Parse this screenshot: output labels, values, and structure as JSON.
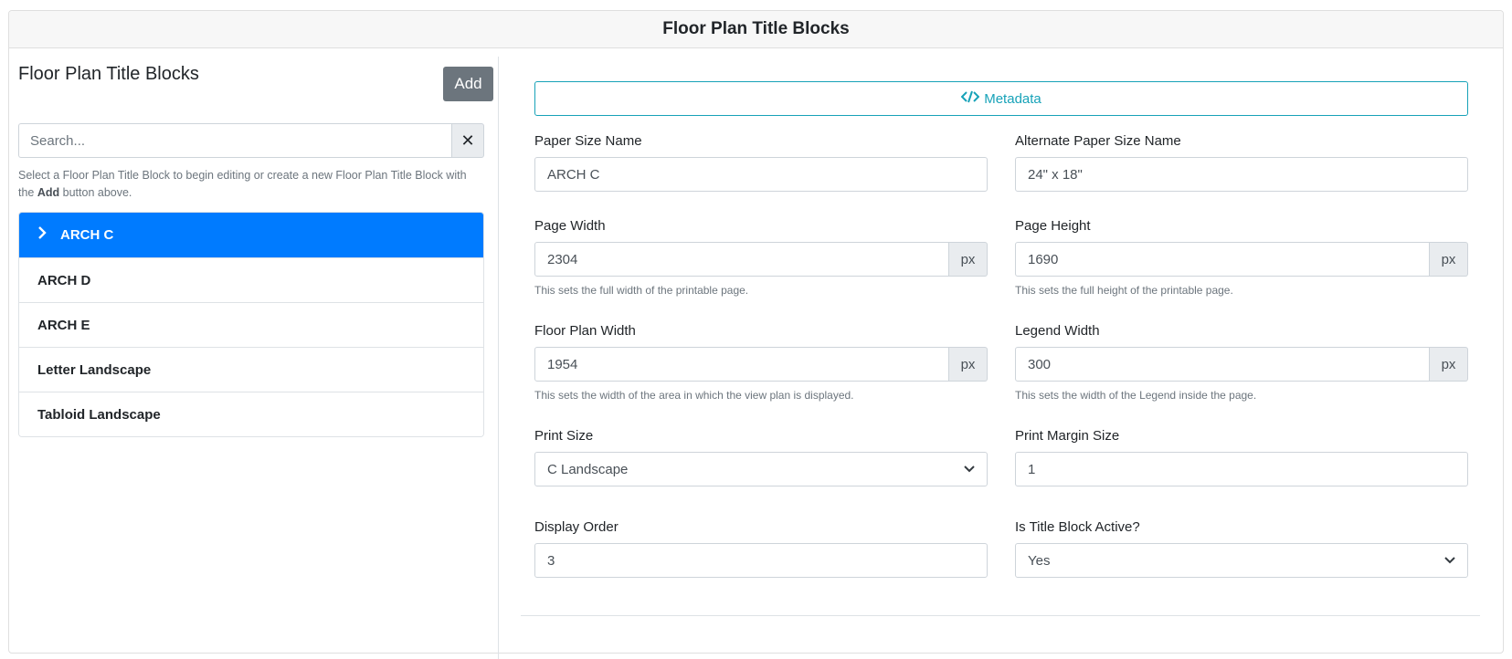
{
  "header": {
    "title": "Floor Plan Title Blocks"
  },
  "sidebar": {
    "title": "Floor Plan Title Blocks",
    "add_label": "Add",
    "search_placeholder": "Search...",
    "clear_icon": "✕",
    "help_prefix": "Select a Floor Plan Title Block to begin editing or create a new Floor Plan Title Block with the ",
    "help_bold": "Add",
    "help_suffix": " button above.",
    "items": [
      {
        "label": "ARCH C",
        "active": true
      },
      {
        "label": "ARCH D"
      },
      {
        "label": "ARCH E"
      },
      {
        "label": "Letter Landscape"
      },
      {
        "label": "Tabloid Landscape"
      }
    ]
  },
  "form": {
    "metadata_label": "Metadata",
    "paper_size_name": {
      "label": "Paper Size Name",
      "value": "ARCH C"
    },
    "alt_paper_size_name": {
      "label": "Alternate Paper Size Name",
      "value": "24\" x 18\""
    },
    "page_width": {
      "label": "Page Width",
      "value": "2304",
      "unit": "px",
      "help": "This sets the full width of the printable page."
    },
    "page_height": {
      "label": "Page Height",
      "value": "1690",
      "unit": "px",
      "help": "This sets the full height of the printable page."
    },
    "floor_plan_width": {
      "label": "Floor Plan Width",
      "value": "1954",
      "unit": "px",
      "help": "This sets the width of the area in which the view plan is displayed."
    },
    "legend_width": {
      "label": "Legend Width",
      "value": "300",
      "unit": "px",
      "help": "This sets the width of the Legend inside the page."
    },
    "print_size": {
      "label": "Print Size",
      "value": "C Landscape"
    },
    "print_margin_size": {
      "label": "Print Margin Size",
      "value": "1"
    },
    "display_order": {
      "label": "Display Order",
      "value": "3"
    },
    "is_active": {
      "label": "Is Title Block Active?",
      "value": "Yes"
    }
  }
}
